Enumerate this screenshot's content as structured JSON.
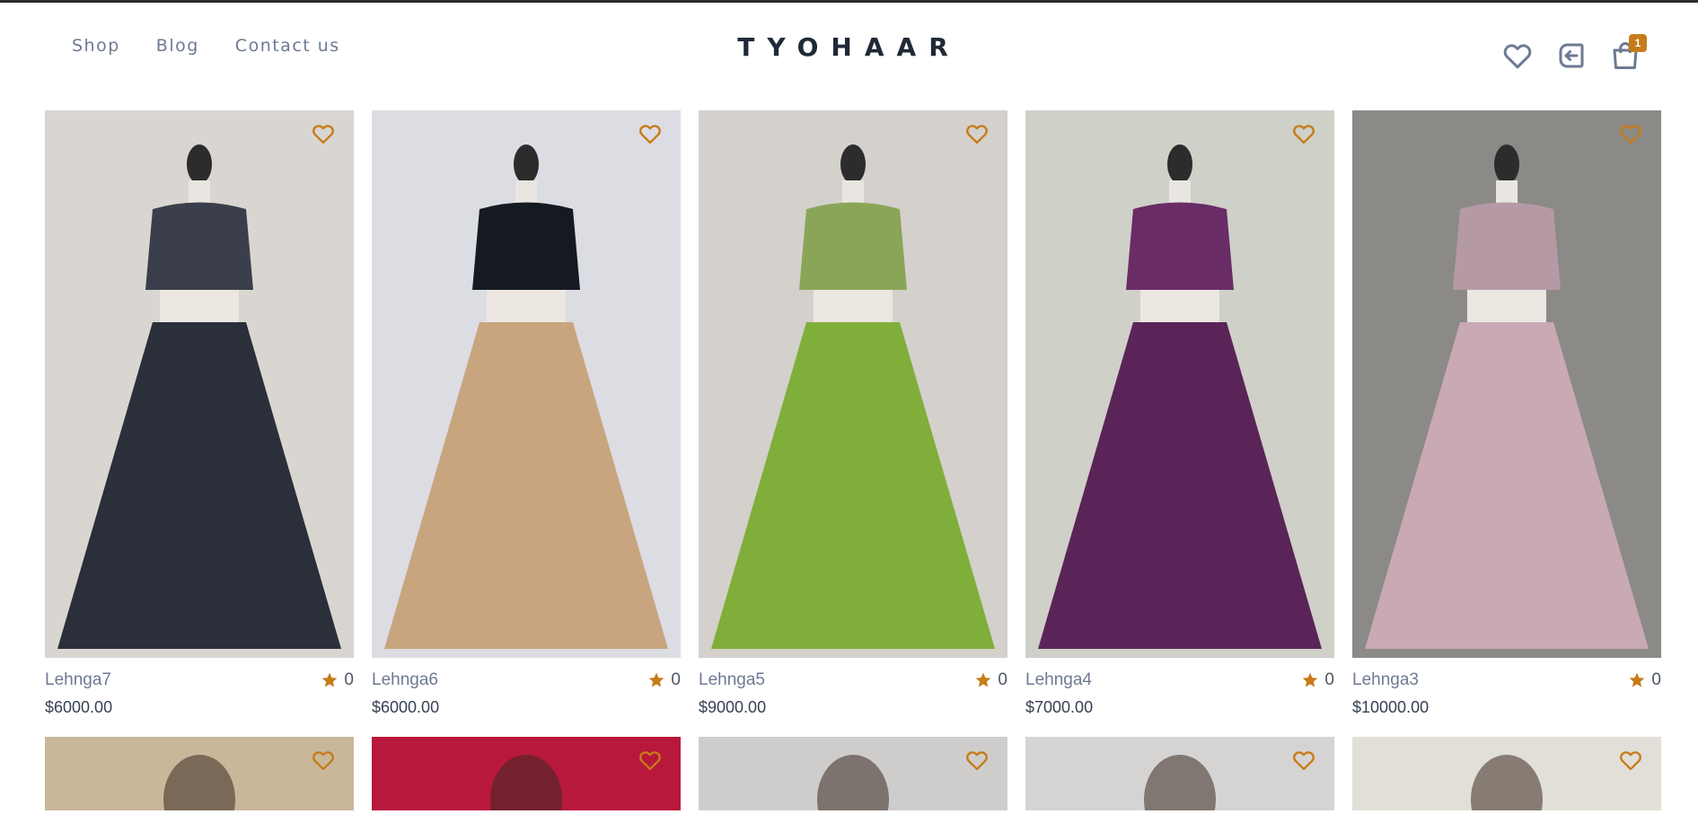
{
  "brand": {
    "name": "TYOHAAR"
  },
  "nav": [
    {
      "label": "Shop"
    },
    {
      "label": "Blog"
    },
    {
      "label": "Contact us"
    }
  ],
  "header_icons": {
    "wishlist_icon": "heart-icon",
    "login_icon": "login-icon",
    "cart_icon": "shopping-bag-icon",
    "cart_count": "1"
  },
  "colors": {
    "accent": "#c77b19",
    "text_muted": "#6e7a93",
    "logo": "#1f2937"
  },
  "products": [
    {
      "name": "Lehnga7",
      "rating": "0",
      "price": "$6000.00",
      "bg": "#d9d6d1",
      "garment": "#2a2f3a",
      "top": "#3b3f4b"
    },
    {
      "name": "Lehnga6",
      "rating": "0",
      "price": "$6000.00",
      "bg": "#dcdce3",
      "garment": "#c8a57f",
      "top": "#151a22"
    },
    {
      "name": "Lehnga5",
      "rating": "0",
      "price": "$9000.00",
      "bg": "#d4d0cc",
      "garment": "#7fae3a",
      "top": "#8aa558"
    },
    {
      "name": "Lehnga4",
      "rating": "0",
      "price": "$7000.00",
      "bg": "#cfd0c8",
      "garment": "#5a2458",
      "top": "#6a2c66"
    },
    {
      "name": "Lehnga3",
      "rating": "0",
      "price": "$10000.00",
      "bg": "#8b8a86",
      "garment": "#c9a9b4",
      "top": "#b59aa5"
    }
  ],
  "products_row2": [
    {
      "bg": "#c9b79a"
    },
    {
      "bg": "#b8183c"
    },
    {
      "bg": "#cfcdcb"
    },
    {
      "bg": "#d6d4d2"
    },
    {
      "bg": "#e2dfd8"
    }
  ]
}
